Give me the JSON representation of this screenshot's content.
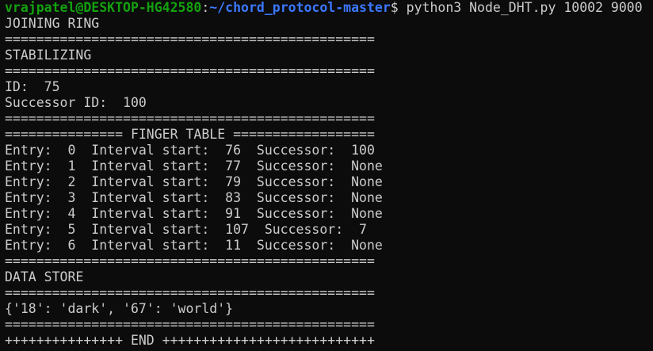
{
  "prompt": {
    "user_host": "vrajpatel@DESKTOP-HG42580",
    "separator": ":",
    "path": "~/chord_protocol-master",
    "dollar": "$ ",
    "command": "python3 Node_DHT.py 10002 9000"
  },
  "colors": {
    "background": "#0c0c0c",
    "text": "#cccccc",
    "user_host": "#13a10e",
    "path": "#3b78ff"
  },
  "output_lines": [
    "JOINING RING",
    "===============================================",
    "STABILIZING",
    "===============================================",
    "ID:  75",
    "Successor ID:  100",
    "===============================================",
    "=============== FINGER TABLE ==================",
    "Entry:  0  Interval start:  76  Successor:  100",
    "Entry:  1  Interval start:  77  Successor:  None",
    "Entry:  2  Interval start:  79  Successor:  None",
    "Entry:  3  Interval start:  83  Successor:  None",
    "Entry:  4  Interval start:  91  Successor:  None",
    "Entry:  5  Interval start:  107  Successor:  7",
    "Entry:  6  Interval start:  11  Successor:  None",
    "===============================================",
    "DATA STORE",
    "===============================================",
    "{'18': 'dark', '67': 'world'}",
    "===============================================",
    "+++++++++++++++ END +++++++++++++++++++++++++++"
  ]
}
